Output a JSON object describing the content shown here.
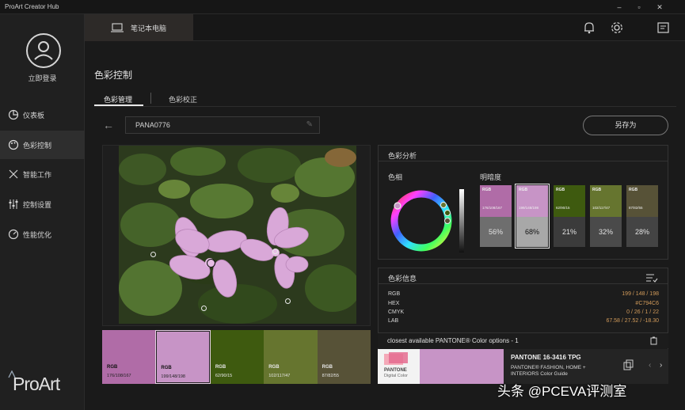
{
  "window": {
    "title": "ProArt Creator Hub"
  },
  "sidebar": {
    "login_label": "立即登录",
    "items": [
      {
        "label": "仪表板",
        "icon": "dashboard-icon"
      },
      {
        "label": "色彩控制",
        "icon": "palette-icon",
        "active": true
      },
      {
        "label": "智能工作",
        "icon": "tools-icon"
      },
      {
        "label": "控制设置",
        "icon": "sliders-icon"
      },
      {
        "label": "性能优化",
        "icon": "performance-icon"
      }
    ],
    "logo_text": "ProArt"
  },
  "topbar": {
    "device_tab": "笔记本电脑"
  },
  "page": {
    "title": "色彩控制",
    "tabs": [
      {
        "label": "色彩管理",
        "active": true
      },
      {
        "label": "色彩校正"
      }
    ],
    "profile_name": "PANA0776",
    "save_as": "另存为"
  },
  "swatches": [
    {
      "label": "RGB",
      "value": "176/108/167",
      "color": "#b06ca7"
    },
    {
      "label": "RGB",
      "value": "199/148/198",
      "color": "#c794c6",
      "selected": true
    },
    {
      "label": "RGB",
      "value": "62/90/15",
      "color": "#3e5a0f",
      "dark": true
    },
    {
      "label": "RGB",
      "value": "102/117/47",
      "color": "#66752f",
      "dark": true
    },
    {
      "label": "RGB",
      "value": "87/82/55",
      "color": "#575237",
      "dark": true
    }
  ],
  "analysis": {
    "title": "色彩分析",
    "hue_label": "色相",
    "brightness_label": "明暗度",
    "bright_cards": [
      {
        "label": "RGB",
        "value": "176/108/167",
        "color": "#b06ca7",
        "percent": "56%"
      },
      {
        "label": "RGB",
        "value": "199/148/198",
        "color": "#c794c6",
        "percent": "68%",
        "selected": true
      },
      {
        "label": "RGB",
        "value": "62/90/15",
        "color": "#3e5a0f",
        "percent": "21%"
      },
      {
        "label": "RGB",
        "value": "102/117/47",
        "color": "#66752f",
        "percent": "32%"
      },
      {
        "label": "RGB",
        "value": "87/82/55",
        "color": "#575237",
        "percent": "28%"
      }
    ]
  },
  "color_info": {
    "title": "色彩信息",
    "rows": [
      {
        "key": "RGB",
        "value": "199 / 148 / 198"
      },
      {
        "key": "HEX",
        "value": "#C794C6"
      },
      {
        "key": "CMYK",
        "value": "0 / 26 / 1 / 22"
      },
      {
        "key": "LAB",
        "value": "67.58 / 27.52 / -18.30"
      }
    ]
  },
  "pantone": {
    "header": "closest available PANTONE® Color options - 1",
    "logo_line1": "PANTONE",
    "logo_line2": "Digital Color",
    "name": "PANTONE 16-3416 TPG",
    "desc": "PANTONE® FASHION, HOME + INTERIORS Color Guide",
    "swatch_color": "#c794c6"
  },
  "watermark": "头条 @PCEVA评测室"
}
